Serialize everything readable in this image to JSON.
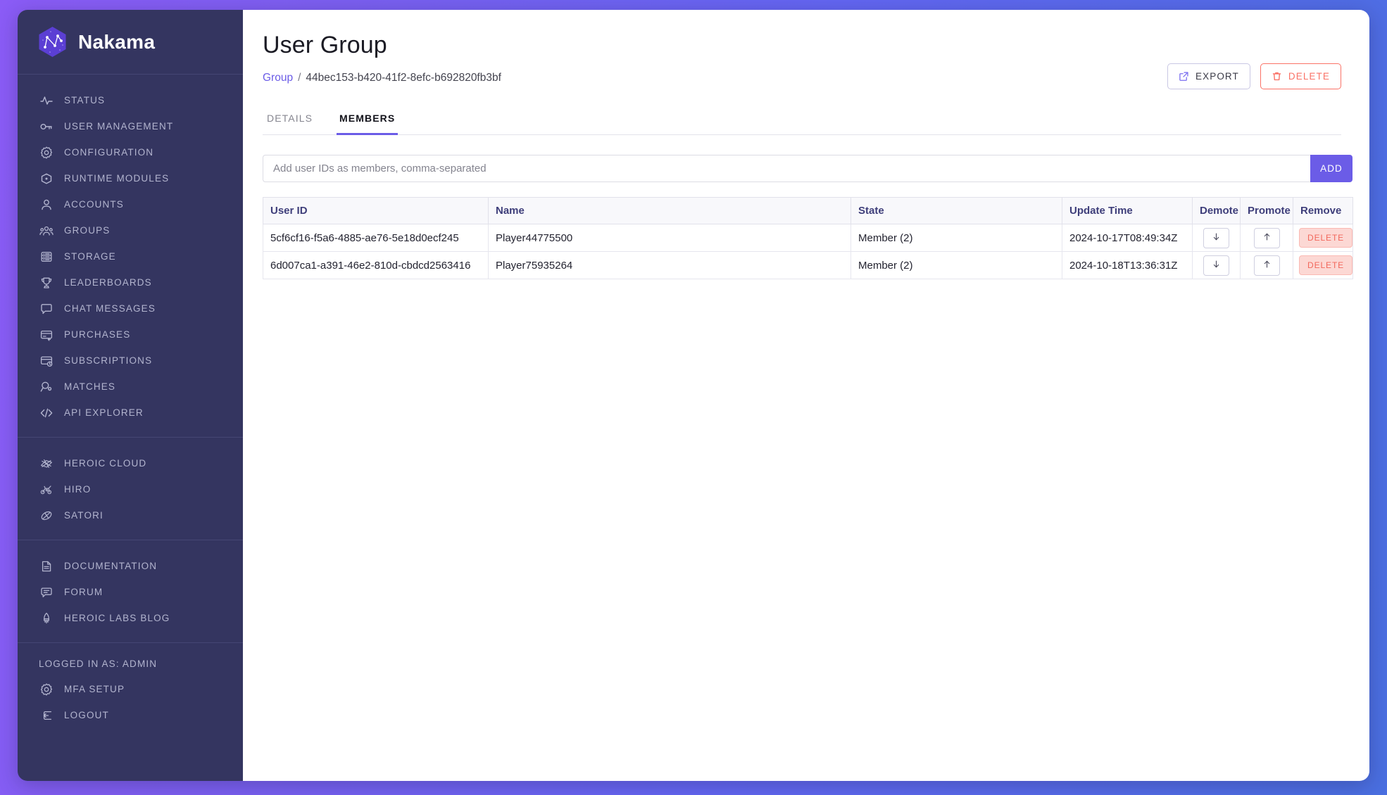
{
  "brand": {
    "name": "Nakama",
    "logo_icon": "nakama-hex-logo"
  },
  "sidebar": {
    "primary_items": [
      {
        "label": "STATUS",
        "icon": "activity-pulse-icon"
      },
      {
        "label": "USER MANAGEMENT",
        "icon": "key-icon"
      },
      {
        "label": "CONFIGURATION",
        "icon": "gear-icon"
      },
      {
        "label": "RUNTIME MODULES",
        "icon": "hexagon-dot-icon"
      },
      {
        "label": "ACCOUNTS",
        "icon": "user-icon"
      },
      {
        "label": "GROUPS",
        "icon": "users-group-icon"
      },
      {
        "label": "STORAGE",
        "icon": "database-list-icon"
      },
      {
        "label": "LEADERBOARDS",
        "icon": "trophy-icon"
      },
      {
        "label": "CHAT MESSAGES",
        "icon": "chat-bubble-icon"
      },
      {
        "label": "PURCHASES",
        "icon": "card-arrow-icon"
      },
      {
        "label": "SUBSCRIPTIONS",
        "icon": "card-clock-icon"
      },
      {
        "label": "MATCHES",
        "icon": "magnifier-dot-icon"
      },
      {
        "label": "API EXPLORER",
        "icon": "code-brackets-icon"
      }
    ],
    "product_items": [
      {
        "label": "HEROIC CLOUD",
        "icon": "heroic-cloud-icon"
      },
      {
        "label": "HIRO",
        "icon": "hiro-icon"
      },
      {
        "label": "SATORI",
        "icon": "satori-icon"
      }
    ],
    "resource_items": [
      {
        "label": "DOCUMENTATION",
        "icon": "document-icon"
      },
      {
        "label": "FORUM",
        "icon": "forum-chat-icon"
      },
      {
        "label": "HEROIC LABS BLOG",
        "icon": "rocket-icon"
      }
    ],
    "account_section_label": "LOGGED IN AS: ADMIN",
    "account_items": [
      {
        "label": "MFA SETUP",
        "icon": "gear-icon"
      },
      {
        "label": "LOGOUT",
        "icon": "logout-icon"
      }
    ]
  },
  "header": {
    "title": "User Group",
    "breadcrumb": {
      "link_label": "Group",
      "separator": "/",
      "current": "44bec153-b420-41f2-8efc-b692820fb3bf"
    },
    "actions": {
      "export_label": "EXPORT",
      "export_icon": "external-link-icon",
      "delete_label": "DELETE",
      "delete_icon": "trash-icon"
    }
  },
  "tabs": [
    {
      "label": "DETAILS",
      "active": false
    },
    {
      "label": "MEMBERS",
      "active": true
    }
  ],
  "add_member": {
    "placeholder": "Add user IDs as members, comma-separated",
    "value": "",
    "button_label": "ADD"
  },
  "members_table": {
    "columns": [
      "User ID",
      "Name",
      "State",
      "Update Time",
      "Demote",
      "Promote",
      "Remove"
    ],
    "rows": [
      {
        "user_id": "5cf6cf16-f5a6-4885-ae76-5e18d0ecf245",
        "name": "Player44775500",
        "state": "Member (2)",
        "update_time": "2024-10-17T08:49:34Z",
        "demote_icon": "arrow-down-icon",
        "promote_icon": "arrow-up-icon",
        "remove_label": "DELETE"
      },
      {
        "user_id": "6d007ca1-a391-46e2-810d-cbdcd2563416",
        "name": "Player75935264",
        "state": "Member (2)",
        "update_time": "2024-10-18T13:36:31Z",
        "demote_icon": "arrow-down-icon",
        "promote_icon": "arrow-up-icon",
        "remove_label": "DELETE"
      }
    ]
  },
  "colors": {
    "accent": "#6b5ce7",
    "sidebar_bg": "#343560",
    "danger": "#fa7267",
    "page_gradient_start": "#8b5cf6",
    "page_gradient_end": "#4a6fe0"
  }
}
